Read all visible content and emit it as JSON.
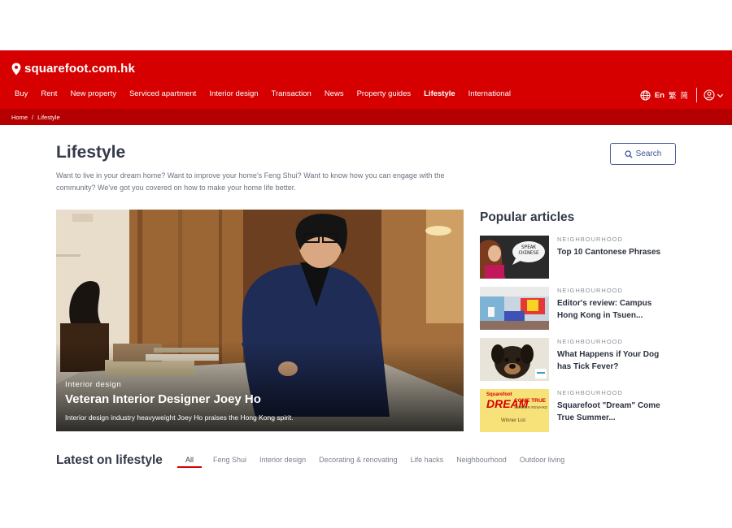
{
  "brand": {
    "name": "squarefoot.com.hk",
    "color": "#d60000",
    "dark": "#b40000"
  },
  "nav": {
    "items": [
      {
        "label": "Buy"
      },
      {
        "label": "Rent"
      },
      {
        "label": "New property"
      },
      {
        "label": "Serviced apartment"
      },
      {
        "label": "Interior design"
      },
      {
        "label": "Transaction"
      },
      {
        "label": "News"
      },
      {
        "label": "Property guides"
      },
      {
        "label": "Lifestyle",
        "active": true
      },
      {
        "label": "International"
      }
    ],
    "lang": {
      "en": "En",
      "trad": "繁",
      "simp": "简"
    }
  },
  "breadcrumb": {
    "home": "Home",
    "sep": "/",
    "current": "Lifestyle"
  },
  "page": {
    "title": "Lifestyle",
    "description": "Want to live in your dream home? Want to improve your home's Feng Shui? Want to know how you can engage with the community? We've got you covered on how to make your home life better.",
    "search_label": "Search"
  },
  "hero": {
    "category": "Interior design",
    "title": "Veteran Interior Designer Joey Ho",
    "subtitle": "Interior design industry heavyweight Joey Ho praises the Hong Kong spirit."
  },
  "popular": {
    "title": "Popular articles",
    "items": [
      {
        "category": "NEIGHBOURHOOD",
        "title": "Top 10 Cantonese Phrases",
        "thumb_text": "SPEAK CHINESE"
      },
      {
        "category": "NEIGHBOURHOOD",
        "title": "Editor's review: Campus Hong Kong in Tsuen..."
      },
      {
        "category": "NEIGHBOURHOOD",
        "title": "What Happens if Your Dog has Tick Fever?"
      },
      {
        "category": "NEIGHBOURHOOD",
        "title": "Squarefoot \"Dream\" Come True Summer...",
        "thumb_brand": "Squarefoot",
        "thumb_dream": "DREAM",
        "thumb_come_true": "COME TRUE",
        "thumb_summer": "SUMMER REWARD",
        "thumb_winner": "Winner List"
      }
    ]
  },
  "latest": {
    "title": "Latest on lifestyle",
    "tabs": [
      {
        "label": "All",
        "active": true
      },
      {
        "label": "Feng Shui"
      },
      {
        "label": "Interior design"
      },
      {
        "label": "Decorating & renovating"
      },
      {
        "label": "Life hacks"
      },
      {
        "label": "Neighbourhood"
      },
      {
        "label": "Outdoor living"
      }
    ]
  },
  "icons": [
    "location-pin-icon",
    "globe-icon",
    "user-icon",
    "chevron-down-icon",
    "search-icon"
  ]
}
